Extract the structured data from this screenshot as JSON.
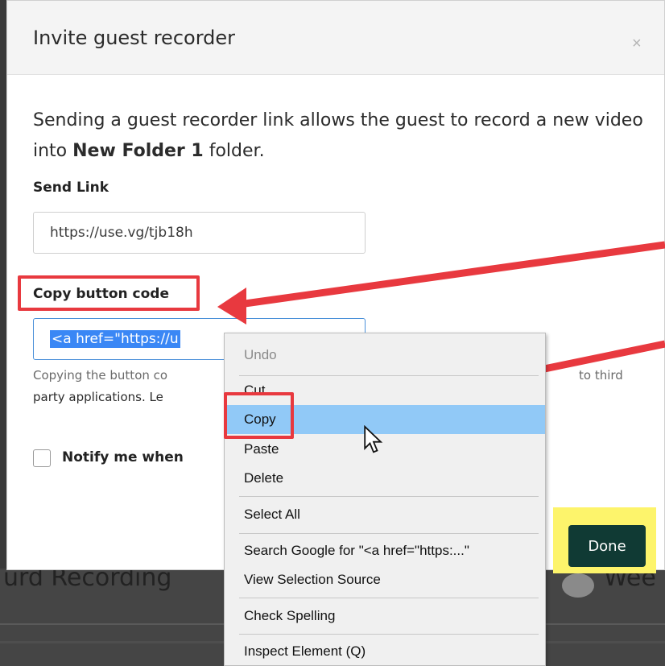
{
  "modal": {
    "title": "Invite guest recorder",
    "close_glyph": "×",
    "description_start": "Sending a guest recorder link allows the guest to record a new video into ",
    "folder_name": "New Folder 1",
    "description_end": " folder.",
    "send_link_label": "Send Link",
    "send_link_value": "https://use.vg/tjb18h",
    "copy_code_label": "Copy button code",
    "copy_code_value": "<a href=\"https://u",
    "helper_start": "Copying the button co",
    "helper_third": "to third",
    "helper_line2": "party applications. Le",
    "notify_label": "Notify me when",
    "done_label": "Done"
  },
  "background": {
    "left_text": "urd Recording",
    "right_text": "Wee"
  },
  "context_menu": {
    "items": [
      {
        "label": "Undo",
        "disabled": true
      },
      {
        "label": "Cut",
        "disabled": false
      },
      {
        "label": "Copy",
        "disabled": false,
        "highlighted": true
      },
      {
        "label": "Paste",
        "disabled": false
      },
      {
        "label": "Delete",
        "disabled": false
      },
      {
        "label": "Select All",
        "disabled": false
      },
      {
        "label": "Search Google for \"<a href=\"https:...\"",
        "disabled": false
      },
      {
        "label": "View Selection Source",
        "disabled": false
      },
      {
        "label": "Check Spelling",
        "disabled": false
      },
      {
        "label": "Inspect Element (Q)",
        "disabled": false
      }
    ]
  },
  "colors": {
    "annotation_red": "#e8393f",
    "done_highlight": "#fdf46b",
    "done_button": "#103a34",
    "menu_highlight": "#91c9f7",
    "selection_blue": "#3a87f5"
  },
  "icons": {
    "close": "close-icon",
    "cursor": "mouse-pointer-icon"
  }
}
